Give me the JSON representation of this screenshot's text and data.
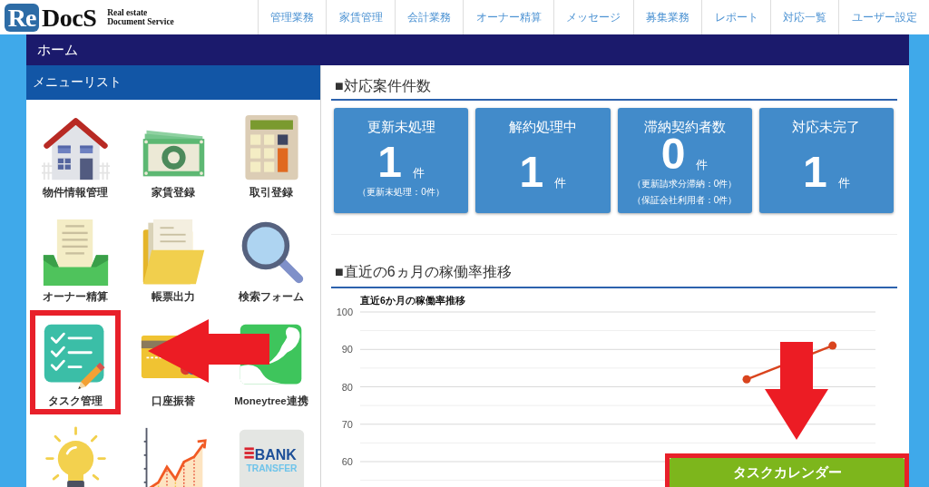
{
  "header": {
    "logo": {
      "mark": "Re",
      "name": "DocS",
      "tagline": [
        "Real estate",
        "Document Service"
      ]
    },
    "nav": [
      "管理業務",
      "家賃管理",
      "会計業務",
      "オーナー精算",
      "メッセージ",
      "募集業務",
      "レポート",
      "対応一覧",
      "ユーザー設定"
    ]
  },
  "page_title": "ホーム",
  "menu": {
    "title": "メニューリスト",
    "items": [
      {
        "kind": "house",
        "label": "物件情報管理",
        "highlighted": false
      },
      {
        "kind": "banknote",
        "label": "家賃登録",
        "highlighted": false
      },
      {
        "kind": "calculator",
        "label": "取引登録",
        "highlighted": false
      },
      {
        "kind": "tray",
        "label": "オーナー精算",
        "highlighted": false
      },
      {
        "kind": "folder",
        "label": "帳票出力",
        "highlighted": false
      },
      {
        "kind": "magnifier",
        "label": "検索フォーム",
        "highlighted": false
      },
      {
        "kind": "checklist",
        "label": "タスク管理",
        "highlighted": true
      },
      {
        "kind": "card",
        "label": "口座振替",
        "highlighted": false
      },
      {
        "kind": "app-logo",
        "label": "Moneytree連携",
        "highlighted": false
      },
      {
        "kind": "lightbulb",
        "highlighted": false
      },
      {
        "kind": "growth-chart",
        "highlighted": false
      },
      {
        "kind": "bank-transfer",
        "icon_text": [
          "BANK",
          "TRANSFER"
        ],
        "highlighted": false
      }
    ]
  },
  "summary": {
    "title": "■対応案件件数",
    "cards": [
      {
        "title": "更新未処理",
        "count": "1",
        "unit": "件",
        "notes": [
          "（更新未処理：0件）"
        ]
      },
      {
        "title": "解約処理中",
        "count": "1",
        "unit": "件"
      },
      {
        "title": "滞納契約者数",
        "count": "0",
        "unit": "件",
        "notes": [
          "（更新請求分滞納：0件）",
          "（保証会社利用者：0件）"
        ]
      },
      {
        "title": "対応未完了",
        "count": "1",
        "unit": "件"
      }
    ]
  },
  "trend": {
    "title": "■直近の6ヵ月の稼働率推移",
    "chart_data": {
      "type": "line",
      "title": "直近6か月の稼働率推移",
      "grid": true,
      "ylim": [
        55,
        100
      ],
      "yticks": [
        60,
        70,
        80,
        90,
        100
      ],
      "series": [
        {
          "color": "#d9441e",
          "marker": true,
          "values": [
            null,
            null,
            null,
            null,
            82,
            91
          ]
        }
      ]
    }
  },
  "task_calendar_button": {
    "label": "タスクカレンダー",
    "highlighted": true
  },
  "annotations": [
    {
      "kind": "left-arrow"
    },
    {
      "kind": "down-arrow"
    }
  ]
}
